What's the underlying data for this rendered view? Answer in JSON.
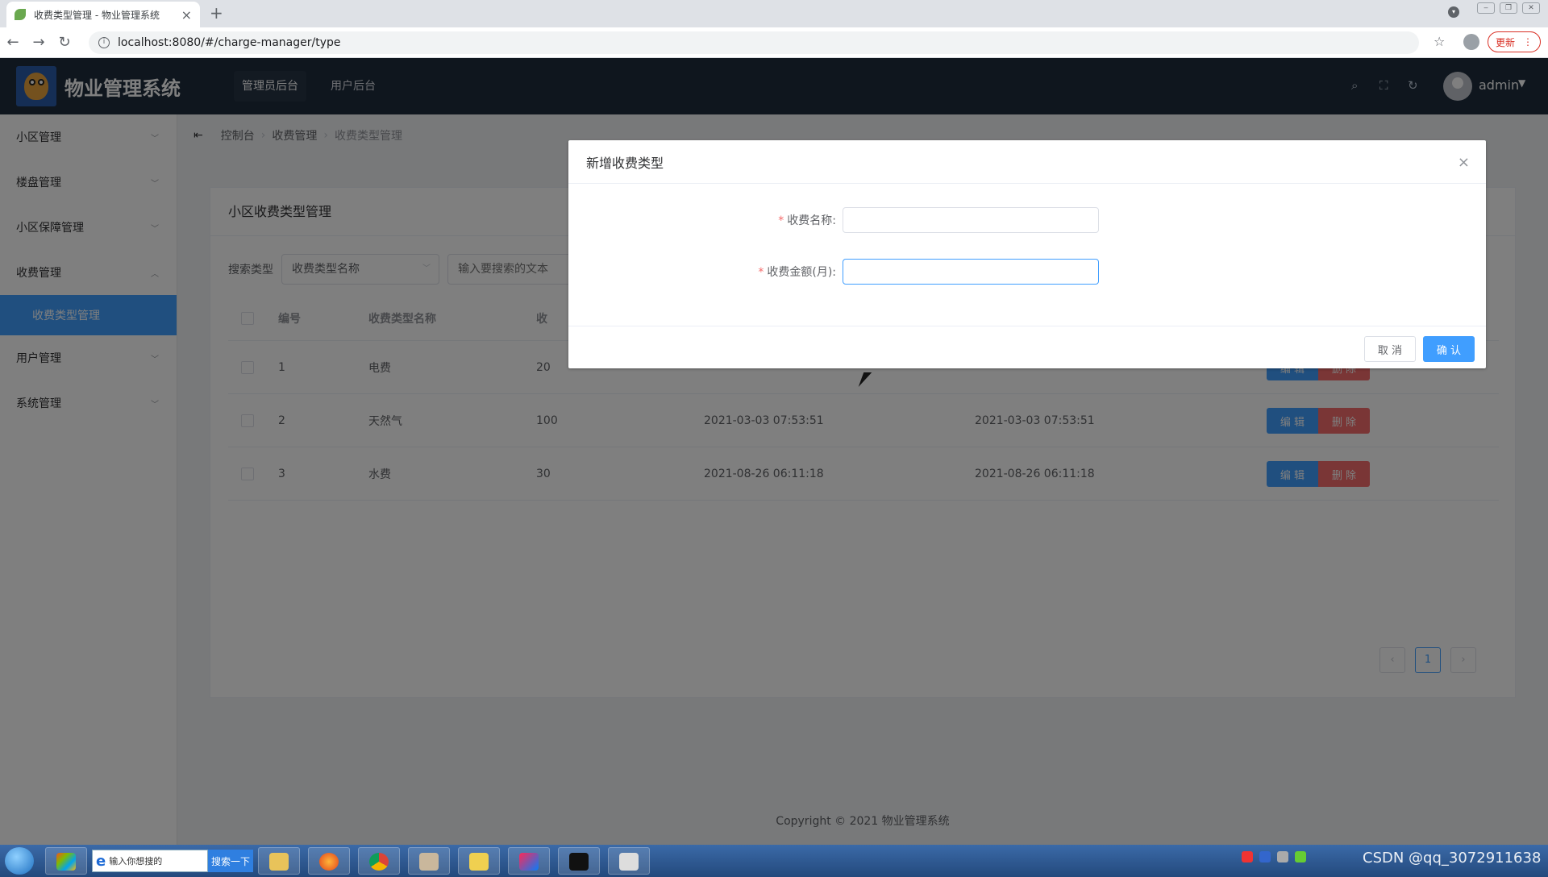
{
  "browser": {
    "tab_title": "收费类型管理 - 物业管理系统",
    "tab_close": "×",
    "new_tab": "+",
    "url": "localhost:8080/#/charge-manager/type",
    "update_label": "更新",
    "update_menu": "⋮"
  },
  "header": {
    "app_title": "物业管理系统",
    "tabs": [
      {
        "label": "管理员后台",
        "active": true
      },
      {
        "label": "用户后台",
        "active": false
      }
    ],
    "username": "admin"
  },
  "sidebar": {
    "items": [
      {
        "label": "小区管理"
      },
      {
        "label": "楼盘管理"
      },
      {
        "label": "小区保障管理"
      },
      {
        "label": "收费管理",
        "expanded": true
      },
      {
        "label": "收费类型管理",
        "active": true
      },
      {
        "label": "用户管理"
      },
      {
        "label": "系统管理"
      }
    ]
  },
  "breadcrumb": [
    "控制台",
    "收费管理",
    "收费类型管理"
  ],
  "card": {
    "title": "小区收费类型管理",
    "search_label": "搜索类型",
    "search_select_value": "收费类型名称",
    "search_placeholder": "输入要搜索的文本"
  },
  "table": {
    "columns": [
      "编号",
      "收费类型名称",
      "收"
    ],
    "rows": [
      {
        "id": "1",
        "name": "电费",
        "amount": "20",
        "created": "",
        "updated": ""
      },
      {
        "id": "2",
        "name": "天然气",
        "amount": "100",
        "created": "2021-03-03 07:53:51",
        "updated": "2021-03-03 07:53:51"
      },
      {
        "id": "3",
        "name": "水费",
        "amount": "30",
        "created": "2021-08-26 06:11:18",
        "updated": "2021-08-26 06:11:18"
      }
    ],
    "edit_label": "编 辑",
    "delete_label": "删 除"
  },
  "pagination": {
    "prev": "‹",
    "current": "1",
    "next": "›"
  },
  "footer": "Copyright © 2021 物业管理系统",
  "dialog": {
    "title": "新增收费类型",
    "close": "×",
    "fields": [
      {
        "label": "收费名称:",
        "required": true,
        "value": ""
      },
      {
        "label": "收费金额(月):",
        "required": true,
        "value": ""
      }
    ],
    "required_mark": "*",
    "cancel_label": "取 消",
    "confirm_label": "确 认"
  },
  "taskbar": {
    "search_placeholder": "输入你想搜的",
    "search_button": "搜索一下",
    "watermark": "CSDN @qq_3072911638"
  },
  "colors": {
    "primary": "#409eff",
    "danger": "#f56c6c",
    "header_bg": "#1f2d3d"
  }
}
